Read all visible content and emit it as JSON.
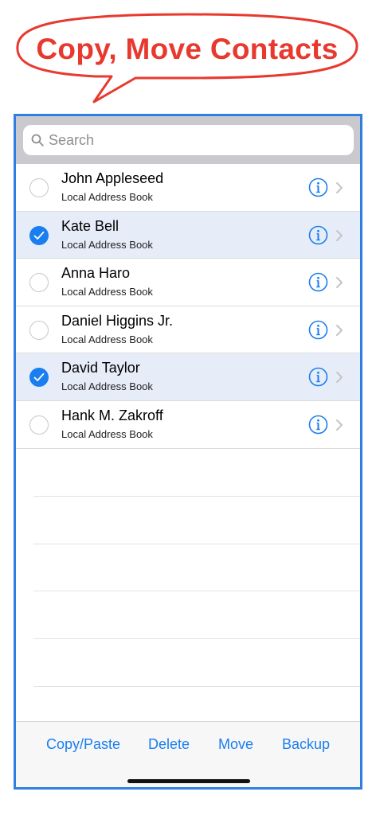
{
  "banner": {
    "title": "Copy, Move Contacts"
  },
  "search": {
    "placeholder": "Search"
  },
  "contacts": [
    {
      "name": "John Appleseed",
      "source": "Local Address Book",
      "selected": false
    },
    {
      "name": "Kate Bell",
      "source": "Local Address Book",
      "selected": true
    },
    {
      "name": "Anna Haro",
      "source": "Local Address Book",
      "selected": false
    },
    {
      "name": "Daniel Higgins Jr.",
      "source": "Local Address Book",
      "selected": false
    },
    {
      "name": "David Taylor",
      "source": "Local Address Book",
      "selected": true
    },
    {
      "name": "Hank M. Zakroff",
      "source": "Local Address Book",
      "selected": false
    }
  ],
  "toolbar": {
    "copy_paste": "Copy/Paste",
    "delete": "Delete",
    "move": "Move",
    "backup": "Backup"
  },
  "colors": {
    "accent": "#1a7ef0",
    "banner": "#e8392f",
    "frame": "#2f7fe0",
    "selected_row": "#e6edf9"
  },
  "icons": [
    "magnifier-icon",
    "checkmark-icon",
    "info-icon",
    "chevron-right-icon"
  ]
}
